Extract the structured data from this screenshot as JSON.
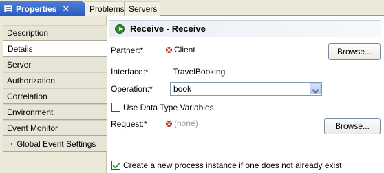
{
  "tabs": [
    {
      "label": "Properties",
      "active": true,
      "icon": "properties-icon"
    },
    {
      "label": "Problems",
      "active": false
    },
    {
      "label": "Servers",
      "active": false
    }
  ],
  "nav": {
    "items": [
      {
        "label": "Description",
        "selected": false
      },
      {
        "label": "Details",
        "selected": true
      },
      {
        "label": "Server",
        "selected": false
      },
      {
        "label": "Authorization",
        "selected": false
      },
      {
        "label": "Correlation",
        "selected": false
      },
      {
        "label": "Environment",
        "selected": false
      },
      {
        "label": "Event Monitor",
        "selected": false
      },
      {
        "label": "Global Event Settings",
        "selected": false,
        "indent": true
      }
    ]
  },
  "header": {
    "title": "Receive - Receive",
    "icon": "receive-arrow-icon"
  },
  "form": {
    "partner_label": "Partner:*",
    "partner_value": "Client",
    "browse_label": "Browse...",
    "interface_label": "Interface:*",
    "interface_value": "TravelBooking",
    "operation_label": "Operation:*",
    "operation_value": "book",
    "use_data_type_label": "Use Data Type Variables",
    "use_data_type_checked": false,
    "request_label": "Request:*",
    "request_value": "(none)",
    "create_instance_label": "Create a new process instance if one does not already exist",
    "create_instance_checked": true
  },
  "colors": {
    "active_tab": "#2a5bc0",
    "error": "#d03030",
    "check": "#21a121"
  }
}
